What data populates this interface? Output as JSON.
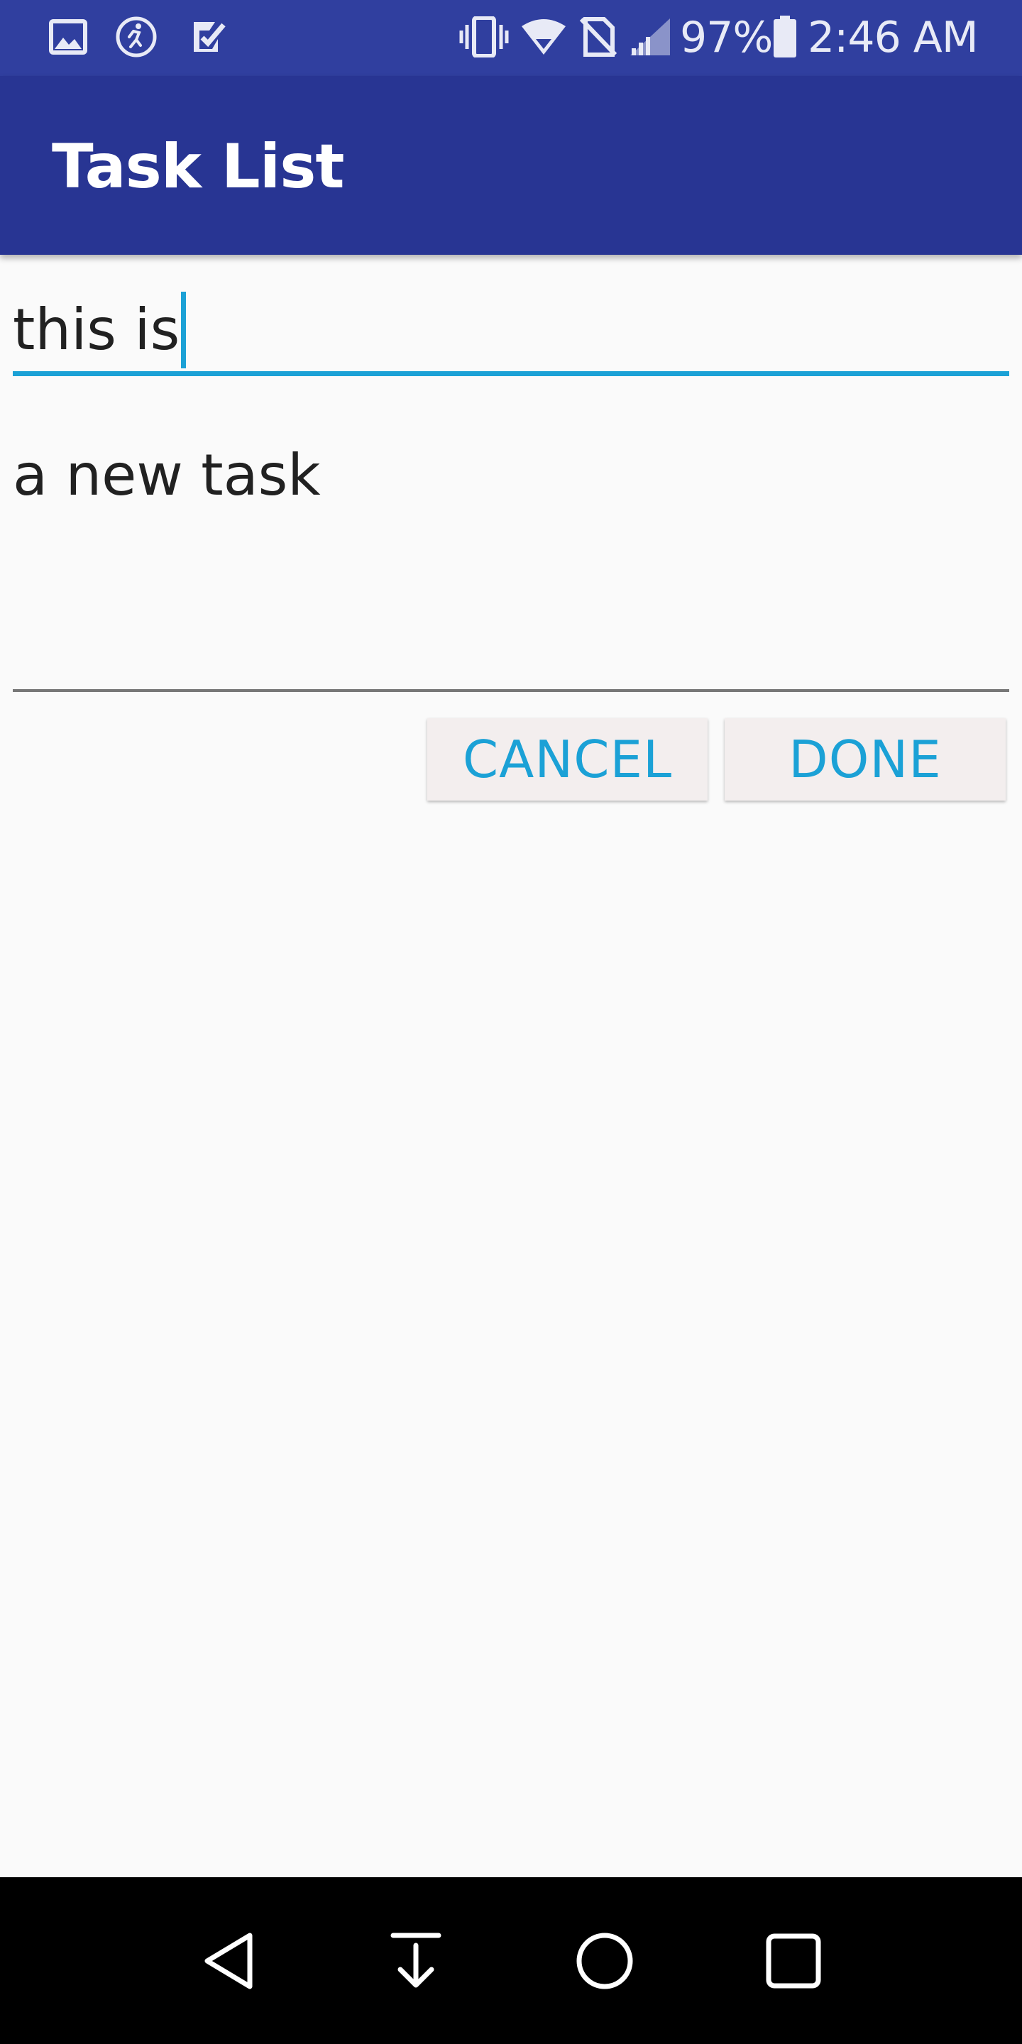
{
  "status_bar": {
    "icons_left": [
      "gallery-icon",
      "activity-icon",
      "tasks-icon"
    ],
    "icons_right": [
      "vibrate-icon",
      "wifi-icon",
      "no-sim-icon",
      "signal-icon",
      "battery-icon"
    ],
    "battery_percent": "97%",
    "time": "2:46 AM"
  },
  "app_bar": {
    "title": "Task List"
  },
  "form": {
    "title_value": "this is",
    "description_value": "a new task"
  },
  "buttons": {
    "cancel_label": "CANCEL",
    "done_label": "DONE"
  },
  "nav_bar": {
    "icons": [
      "back-icon",
      "notification-pull-icon",
      "home-icon",
      "recents-icon"
    ]
  },
  "colors": {
    "status_bar": "#303f9f",
    "app_bar": "#283593",
    "accent": "#1ba1d6",
    "background": "#fafafa"
  }
}
